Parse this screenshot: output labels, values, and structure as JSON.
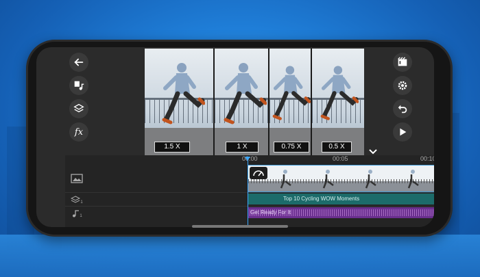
{
  "colors": {
    "accent": "#3ba7ff",
    "text_track": "#1c6b6a",
    "audio_track": "#6a2f8f",
    "background": "#1f7ed8"
  },
  "left_toolbar": [
    {
      "icon": "back-arrow-icon"
    },
    {
      "icon": "media-music-icon"
    },
    {
      "icon": "layers-icon"
    },
    {
      "icon": "fx-icon",
      "label": "fx"
    }
  ],
  "right_toolbar": [
    {
      "icon": "export-film-icon"
    },
    {
      "icon": "settings-gear-icon"
    },
    {
      "icon": "undo-icon"
    },
    {
      "icon": "play-icon"
    }
  ],
  "preview": {
    "speeds": [
      "1.5 X",
      "1 X",
      "0.75 X",
      "0.5 X"
    ],
    "collapse_icon": "chevron-down-icon"
  },
  "timeline": {
    "timecodes": [
      "00:00",
      "00:05",
      "00:10"
    ],
    "text_clip": "Top 10 Cycling WOW Moments",
    "audio_clip": "Get Ready For It",
    "track_badges": [
      "1",
      "1"
    ]
  }
}
